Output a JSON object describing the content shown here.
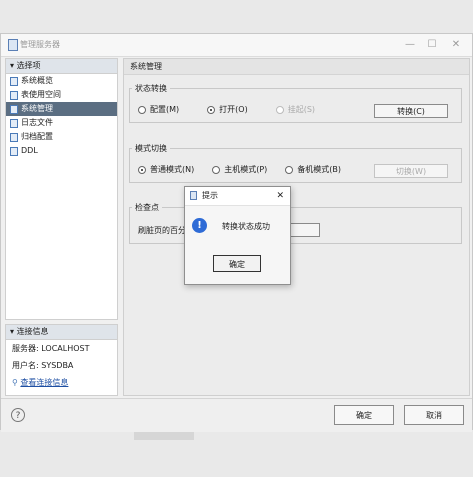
{
  "window": {
    "title": "管理服务器"
  },
  "sidebar": {
    "nav_header": "选择项",
    "items": [
      {
        "label": "系统概览"
      },
      {
        "label": "表使用空间"
      },
      {
        "label": "系统管理"
      },
      {
        "label": "日志文件"
      },
      {
        "label": "归档配置"
      },
      {
        "label": "DDL"
      }
    ],
    "selected_index": 2,
    "connection": {
      "header": "连接信息",
      "server_label": "服务器: LOCALHOST",
      "user_label": "用户名: SYSDBA",
      "link_label": "查看连接信息"
    }
  },
  "main": {
    "title": "系统管理",
    "state_group": {
      "legend": "状态转换",
      "options": [
        {
          "label": "配置(M)",
          "checked": false,
          "disabled": false
        },
        {
          "label": "打开(O)",
          "checked": true,
          "disabled": false
        },
        {
          "label": "挂起(S)",
          "checked": false,
          "disabled": true
        }
      ],
      "button": "转换(C)"
    },
    "mode_group": {
      "legend": "模式切换",
      "options": [
        {
          "label": "普通模式(N)",
          "checked": true
        },
        {
          "label": "主机模式(P)",
          "checked": false
        },
        {
          "label": "备机模式(B)",
          "checked": false
        }
      ],
      "button": "切换(W)"
    },
    "checkpoint_group": {
      "legend": "检查点",
      "row_label": "刷脏页的百分比"
    }
  },
  "footer": {
    "help": "?",
    "ok": "确定",
    "cancel": "取消"
  },
  "dialog": {
    "title": "提示",
    "close": "✕",
    "icon": "!",
    "message": "转换状态成功",
    "ok": "确定"
  }
}
